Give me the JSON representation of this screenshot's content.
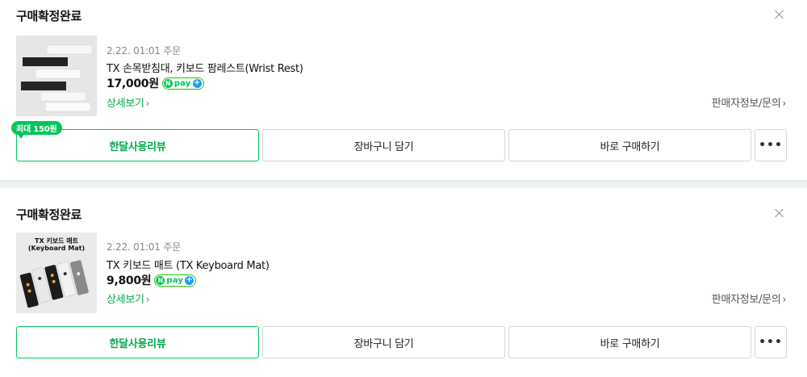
{
  "orders": [
    {
      "status": "구매확정완료",
      "order_date": "2.22. 01:01 주문",
      "product_name": "TX 손목받침대, 키보드 팜레스트(Wrist Rest)",
      "price": "17,000원",
      "npay": {
        "n": "N",
        "text": "pay",
        "plus": "+"
      },
      "detail_link": "상세보기",
      "seller_link": "판매자정보/문의",
      "reward_badge": "최대 150원",
      "buttons": {
        "review": "한달사용리뷰",
        "cart": "장바구니 담기",
        "buy": "바로 구매하기",
        "more": "•••"
      },
      "thumbnail_icon": "wrist-rest-product-image"
    },
    {
      "status": "구매확정완료",
      "order_date": "2.22. 01:01 주문",
      "product_name": "TX 키보드 매트 (TX Keyboard Mat)",
      "price": "9,800원",
      "npay": {
        "n": "N",
        "text": "pay",
        "plus": "+"
      },
      "detail_link": "상세보기",
      "seller_link": "판매자정보/문의",
      "buttons": {
        "review": "한달사용리뷰",
        "cart": "장바구니 담기",
        "buy": "바로 구매하기",
        "more": "•••"
      },
      "thumbnail_title": [
        "TX 키보드 매트",
        "(Keyboard Mat)"
      ],
      "thumbnail_icon": "keyboard-mat-product-image"
    }
  ],
  "colors": {
    "accent": "#03c75a",
    "accent_text": "#03a94d",
    "npay_plus": "#1a9ef5",
    "divider": "#eef1f4"
  }
}
